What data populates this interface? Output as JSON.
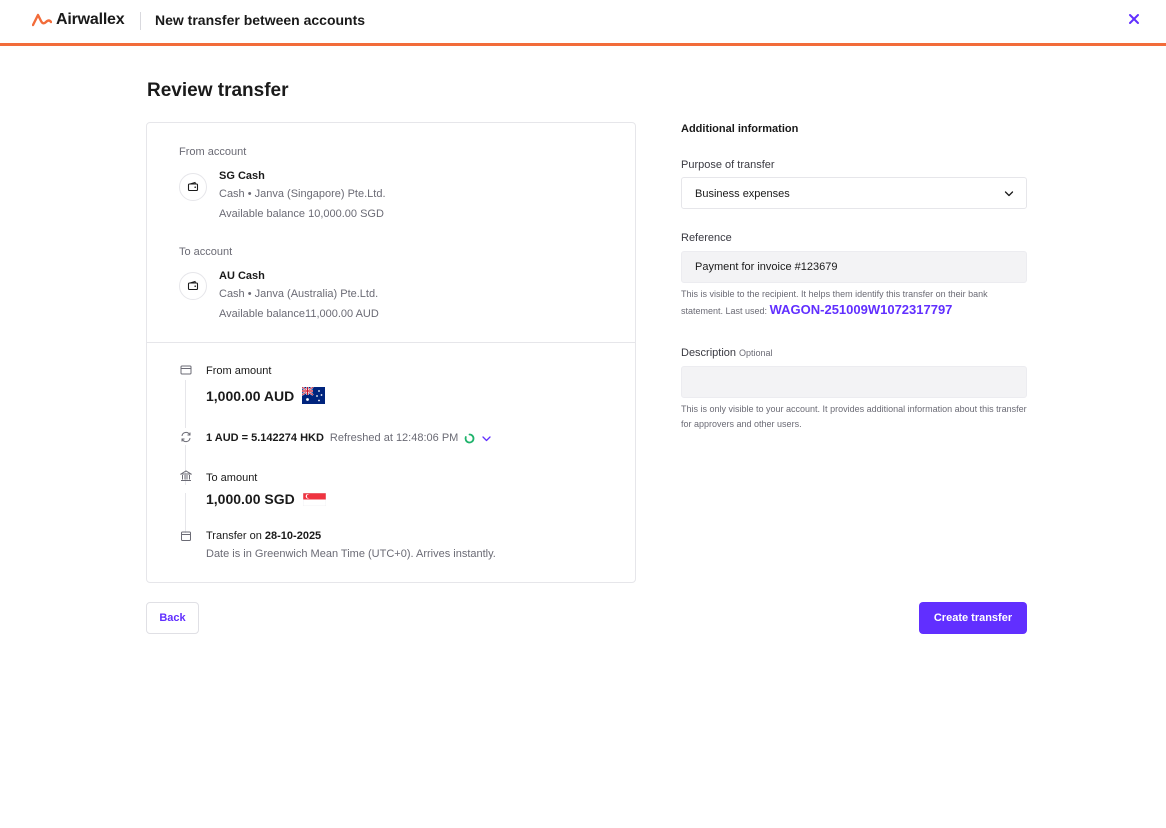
{
  "header": {
    "brand": "Airwallex",
    "title": "New transfer between accounts",
    "brand_color": "#f26c3a"
  },
  "page_title": "Review transfer",
  "from_account": {
    "label": "From account",
    "name": "SG Cash",
    "entity": "Cash • Janva (Singapore) Pte.Ltd.",
    "balance": "Available balance 10,000.00 SGD"
  },
  "to_account": {
    "label": "To account",
    "name": "AU Cash",
    "entity": "Cash • Janva (Australia) Pte.Ltd.",
    "balance": "Available balance11,000.00 AUD"
  },
  "from_amount": {
    "label": "From amount",
    "value": "1,000.00 AUD"
  },
  "rate": {
    "value": "1 AUD = 5.142274 HKD",
    "refreshed": "Refreshed at 12:48:06 PM"
  },
  "to_amount": {
    "label": "To amount",
    "value": "1,000.00 SGD"
  },
  "transfer_date": {
    "prefix": "Transfer on",
    "date": "28-10-2025",
    "note": "Date is in Greenwich Mean Time (UTC+0). Arrives instantly."
  },
  "additional": {
    "title": "Additional information",
    "purpose_label": "Purpose of transfer",
    "purpose_value": "Business expenses",
    "reference_label": "Reference",
    "reference_value": "Payment for invoice #123679",
    "reference_help": "This is visible to the recipient. It helps them identify this transfer on their bank statement. Last used:",
    "reference_last_used": "WAGON-251009W1072317797",
    "description_label": "Description",
    "description_optional": "Optional",
    "description_value": "",
    "description_help": "This is only visible to your account. It provides additional information about this transfer for approvers and other users."
  },
  "buttons": {
    "back": "Back",
    "create": "Create transfer"
  },
  "colors": {
    "accent": "#612fff",
    "header_border": "#f26c3a",
    "rate_spinner": "#1fb36b"
  }
}
